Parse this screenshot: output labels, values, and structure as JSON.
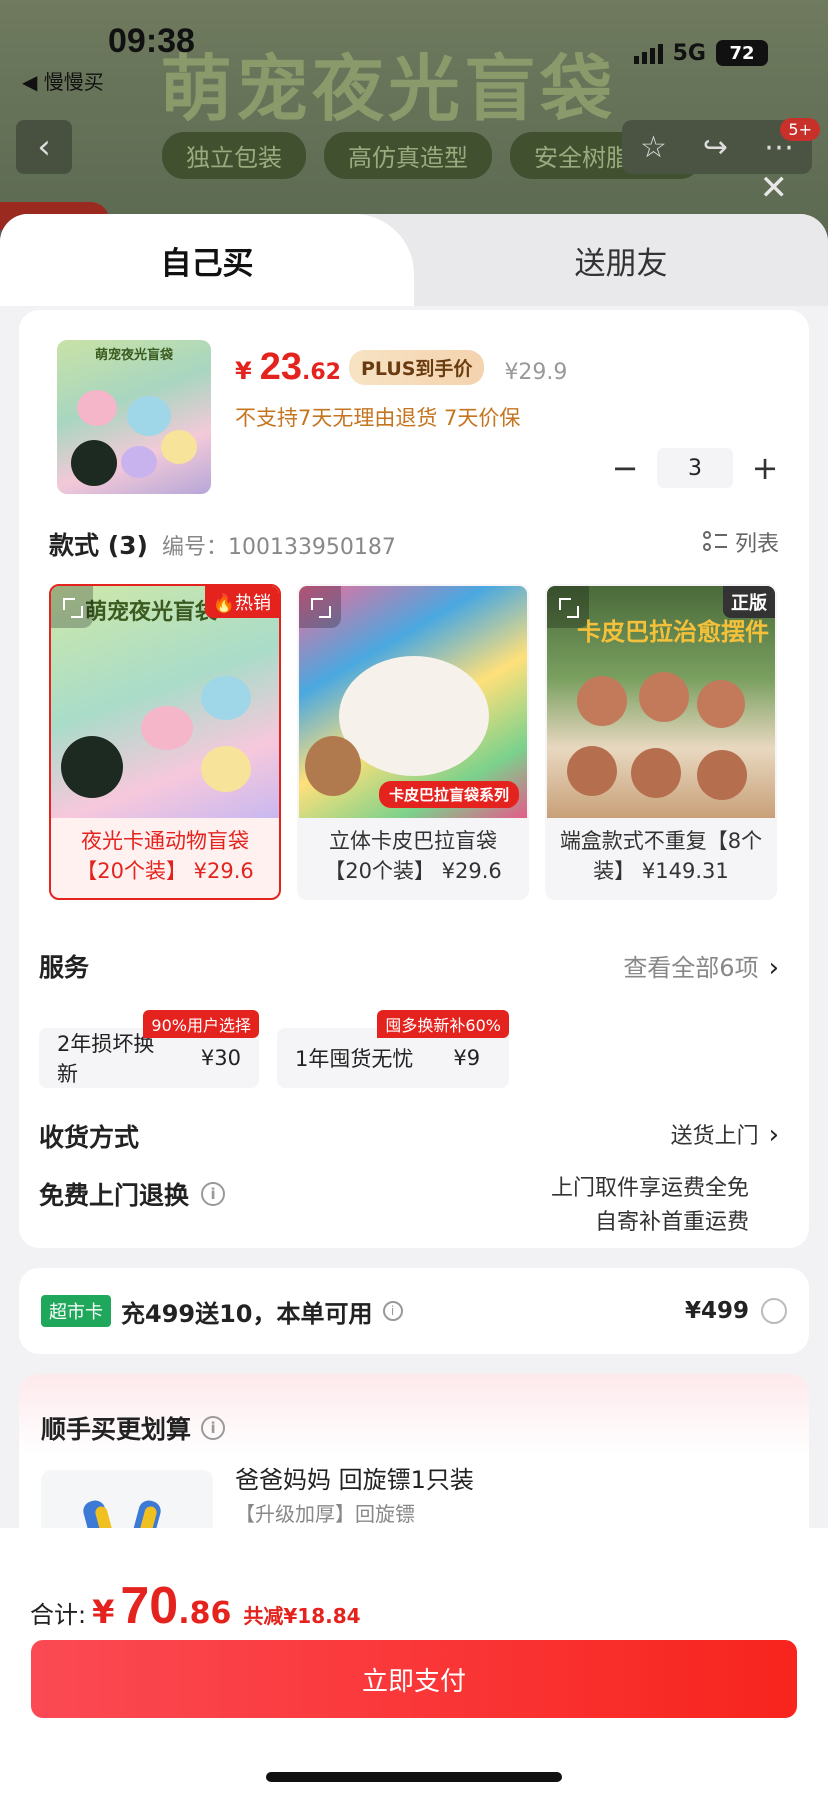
{
  "status": {
    "time": "09:38",
    "back_app": "◀ 慢慢买",
    "network": "5G",
    "battery": "72"
  },
  "background": {
    "title": "萌宠夜光盲袋",
    "tags": [
      "独立包装",
      "高仿真造型",
      "安全树脂材质"
    ],
    "badge": "5+"
  },
  "tabs": {
    "self": "自己买",
    "gift": "送朋友"
  },
  "product": {
    "image_label": "萌宠夜光盲袋",
    "price_currency": "¥",
    "price_integer": "23",
    "price_decimal": ".62",
    "plus_tag": "PLUS到手价",
    "original_price": "¥29.9",
    "notice": "不支持7天无理由退货   7天价保",
    "quantity": "3"
  },
  "styles": {
    "title": "款式 (3)",
    "code": "编号：100133950187",
    "list_label": "列表",
    "items": [
      {
        "thumb_label": "萌宠夜光盲袋",
        "badge": "热销",
        "text": "夜光卡通动物盲袋【20个装】 ¥29.6",
        "selected": true
      },
      {
        "thumb_label": "卡皮巴拉盲袋系列",
        "badge": "",
        "text": "立体卡皮巴拉盲袋【20个装】 ¥29.6",
        "selected": false
      },
      {
        "thumb_label": "卡皮巴拉治愈摆件",
        "badge": "正版",
        "text": "端盒款式不重复【8个装】 ¥149.31",
        "selected": false
      }
    ]
  },
  "service": {
    "title": "服务",
    "view_all": "查看全部6项",
    "chips": [
      {
        "name": "2年损坏换新",
        "price": "¥30",
        "tag": "90%用户选择"
      },
      {
        "name": "1年囤货无忧",
        "price": "¥9",
        "tag": "囤多换新补60%"
      }
    ]
  },
  "delivery": {
    "label": "收货方式",
    "value": "送货上门"
  },
  "returns": {
    "label": "免费上门退换",
    "line1": "上门取件享运费全免",
    "line2": "自寄补首重运费"
  },
  "club": {
    "badge": "超市卡",
    "text": "充499送10，本单可用",
    "price": "¥499"
  },
  "addon": {
    "title": "顺手买更划算",
    "name": "爸爸妈妈 回旋镖1只装",
    "sub": "【升级加厚】回旋镖"
  },
  "bottom": {
    "total_label": "合计:",
    "currency": "¥",
    "total_integer": "70",
    "total_decimal": ".86",
    "saving": "共减¥18.84",
    "pay_label": "立即支付"
  },
  "colors": {
    "accent": "#e5231e",
    "pay_start": "#fb4a54",
    "pay_end": "#f8241d",
    "club_green": "#1fa85b"
  }
}
